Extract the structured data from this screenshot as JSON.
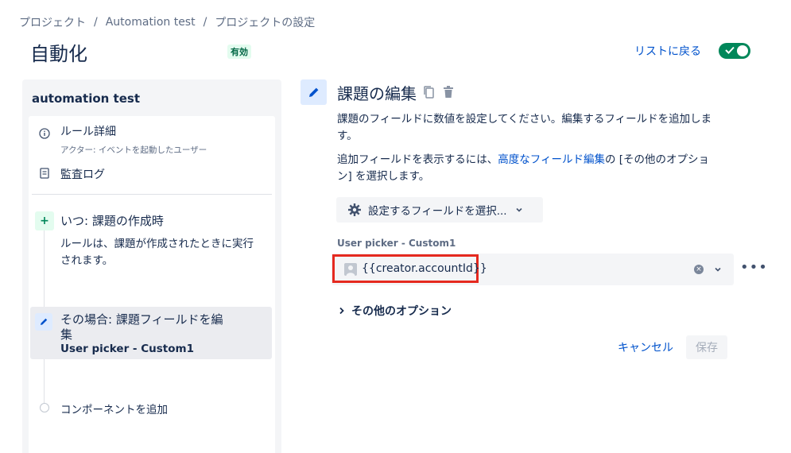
{
  "breadcrumb": {
    "items": [
      "プロジェクト",
      "Automation test",
      "プロジェクトの設定"
    ],
    "separator": "/"
  },
  "header": {
    "title": "自動化",
    "status_badge": "有効",
    "back_link": "リストに戻る",
    "toggle_on": true
  },
  "sidebar": {
    "rule_name": "automation test",
    "rule_details": {
      "label": "ルール詳細",
      "sub": "アクター: イベントを起動したユーザー",
      "icon": "info-icon"
    },
    "audit_log": {
      "label": "監査ログ",
      "icon": "document-icon"
    },
    "trigger": {
      "title": "いつ: 課題の作成時",
      "desc_line1": "ルールは、課題が作成されたときに実行",
      "desc_line2": "されます。",
      "icon": "plus-icon"
    },
    "action": {
      "title_line1": "その場合: 課題フィールドを編",
      "title_line2": "集",
      "sub": "User picker - Custom1",
      "icon": "pencil-icon"
    },
    "add_component": "コンポーネントを追加"
  },
  "editor": {
    "title": "課題の編集",
    "desc1_line1": "課題のフィールドに数値を設定してください。編集するフィールドを追加しま",
    "desc1_line2": "す。",
    "desc2_prefix": "追加フィールドを表示するには、",
    "desc2_link": "高度なフィールド編集",
    "desc2_suffix": "の [その他のオプショ",
    "desc2_line2": "ン] を選択します。",
    "field_select_button": "設定するフィールドを選択...",
    "field_label": "User picker - Custom1",
    "field_value": "{{creator.accountId}}",
    "more_options": "その他のオプション",
    "cancel": "キャンセル",
    "save": "保存"
  },
  "colors": {
    "accent": "#0052cc",
    "toggle": "#00875a",
    "highlight": "#e5291f"
  }
}
